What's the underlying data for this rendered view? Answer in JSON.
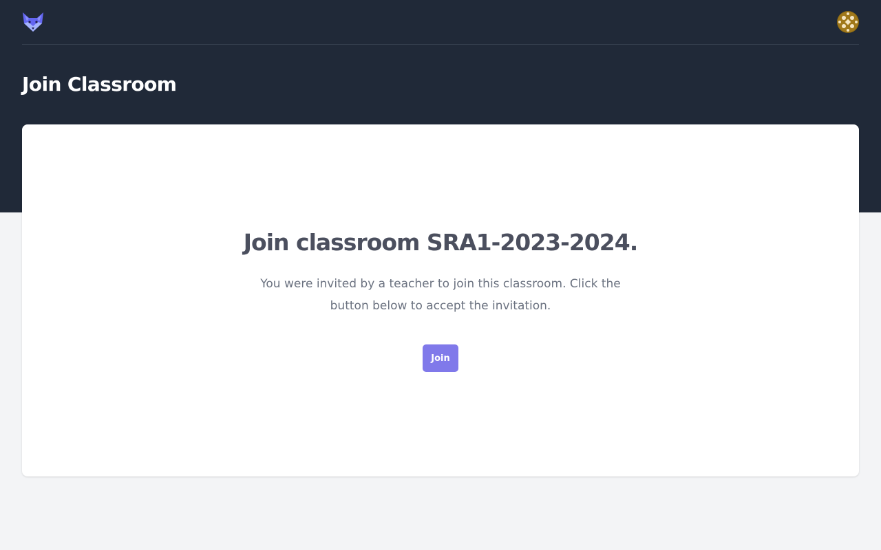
{
  "header": {
    "logo_icon": "fox-logo-icon",
    "avatar_icon": "user-avatar-icon"
  },
  "page": {
    "title": "Join Classroom"
  },
  "card": {
    "heading": "Join classroom SRA1-2023-2024.",
    "description": "You were invited by a teacher to join this classroom. Click the button below to accept the invitation.",
    "join_label": "Join"
  },
  "colors": {
    "header_bg": "#202938",
    "page_bg": "#f3f4f6",
    "accent": "#8079ea",
    "logo": "#6366f1"
  }
}
